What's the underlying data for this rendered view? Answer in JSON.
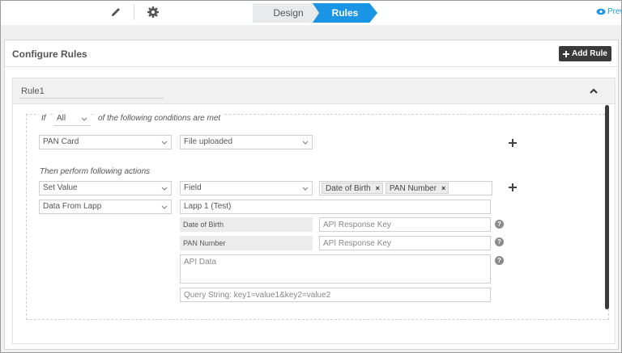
{
  "steps": {
    "design": "Design",
    "rules": "Rules",
    "preview": "Prev"
  },
  "header": {
    "title": "Configure Rules",
    "add_rule": "Add Rule"
  },
  "rule": {
    "name": "Rule1"
  },
  "condition": {
    "if_label": "If",
    "match_value": "All",
    "suffix_label": "of the following conditions are met",
    "field": "PAN Card",
    "operator": "File uploaded"
  },
  "actions": {
    "label": "Then perform following actions",
    "action_type": "Set Value",
    "target": "Field",
    "tags": [
      "Date of Birth",
      "PAN Number"
    ],
    "source": "Data From Lapp",
    "lapp_value": "Lapp 1 (Test)",
    "mappings": [
      {
        "label": "Date of Birth",
        "placeholder": "API Response Key"
      },
      {
        "label": "PAN Number",
        "placeholder": "API Response Key"
      }
    ],
    "api_data_placeholder": "API Data",
    "query_placeholder": "Query String: key1=value1&key2=value2"
  },
  "colors": {
    "accent": "#1a95e6",
    "dark_button": "#3a3a3a",
    "scrollbar": "#3b3b3b"
  }
}
